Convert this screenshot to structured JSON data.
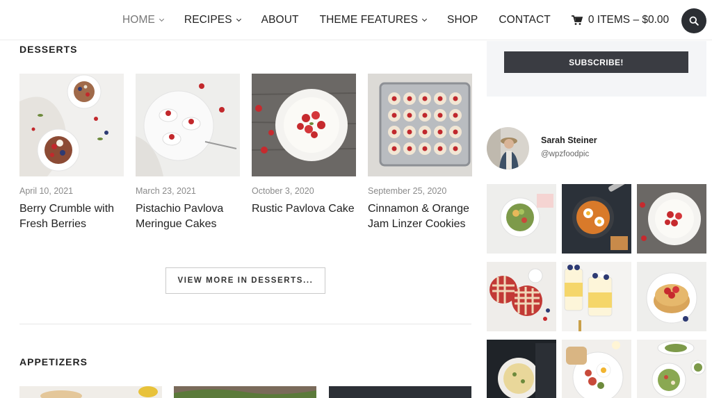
{
  "nav": {
    "items": [
      {
        "label": "HOME",
        "dropdown": true,
        "active": true
      },
      {
        "label": "RECIPES",
        "dropdown": true,
        "active": false
      },
      {
        "label": "ABOUT",
        "dropdown": false,
        "active": false
      },
      {
        "label": "THEME FEATURES",
        "dropdown": true,
        "active": false
      },
      {
        "label": "SHOP",
        "dropdown": false,
        "active": false
      },
      {
        "label": "CONTACT",
        "dropdown": false,
        "active": false
      }
    ],
    "cart_label": "0 ITEMS – $0.00",
    "cart_icon": "shopping-cart-icon",
    "search_icon": "search-icon"
  },
  "desserts": {
    "title": "DESSERTS",
    "posts": [
      {
        "date": "April 10, 2021",
        "title": "Berry Crumble with Fresh Berries"
      },
      {
        "date": "March 23, 2021",
        "title": "Pistachio Pavlova Meringue Cakes"
      },
      {
        "date": "October 3, 2020",
        "title": "Rustic Pavlova Cake"
      },
      {
        "date": "September 25, 2020",
        "title": "Cinnamon & Orange Jam Linzer Cookies"
      }
    ],
    "view_more": "VIEW MORE IN DESSERTS..."
  },
  "appetizers": {
    "title": "APPETIZERS"
  },
  "sidebar": {
    "subscribe_label": "SUBSCRIBE!",
    "profile": {
      "name": "Sarah Steiner",
      "handle": "@wpzfoodpic"
    }
  },
  "colors": {
    "dark_button": "#3a3c42",
    "search_button": "#2b2e33",
    "subscribe_bg": "#f4f5f7",
    "muted_text": "#8a8a8a"
  }
}
